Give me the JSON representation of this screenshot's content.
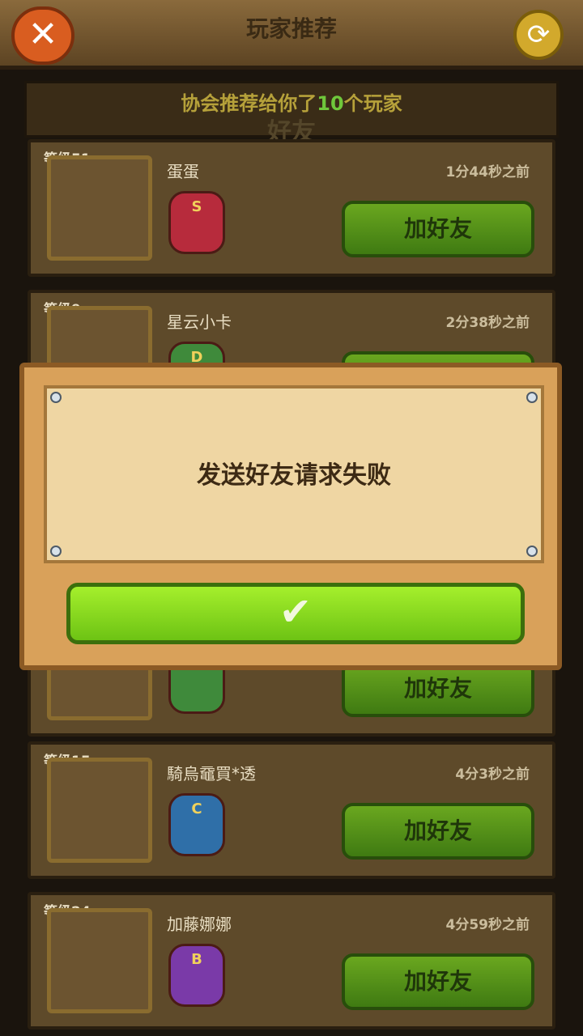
{
  "header": {
    "title": "玩家推荐",
    "close_icon": "close-icon",
    "refresh_icon": "refresh-icon"
  },
  "banner": {
    "text_prefix": "协会推荐给你了",
    "count": "10",
    "text_suffix": "个玩家",
    "tab_label": "好友"
  },
  "players": [
    {
      "level": "等级51",
      "name": "蛋蛋",
      "time": "1分44秒之前",
      "badge": "S",
      "button": "加好友"
    },
    {
      "level": "等级9",
      "name": "星云小卡",
      "time": "2分38秒之前",
      "badge": "D",
      "button": "加好友"
    },
    {
      "level": "",
      "name": "",
      "time": "",
      "badge": "",
      "button": "加好友"
    },
    {
      "level": "等级15",
      "name": "騎烏黿買*透",
      "time": "4分3秒之前",
      "badge": "C",
      "button": "加好友"
    },
    {
      "level": "等级24",
      "name": "加藤娜娜",
      "time": "4分59秒之前",
      "badge": "B",
      "button": "加好友"
    }
  ],
  "dialog": {
    "message": "发送好友请求失败",
    "confirm_icon": "checkmark-icon"
  },
  "colors": {
    "accent_green": "#6fc73b",
    "dialog_button": "#8fdc1f"
  }
}
